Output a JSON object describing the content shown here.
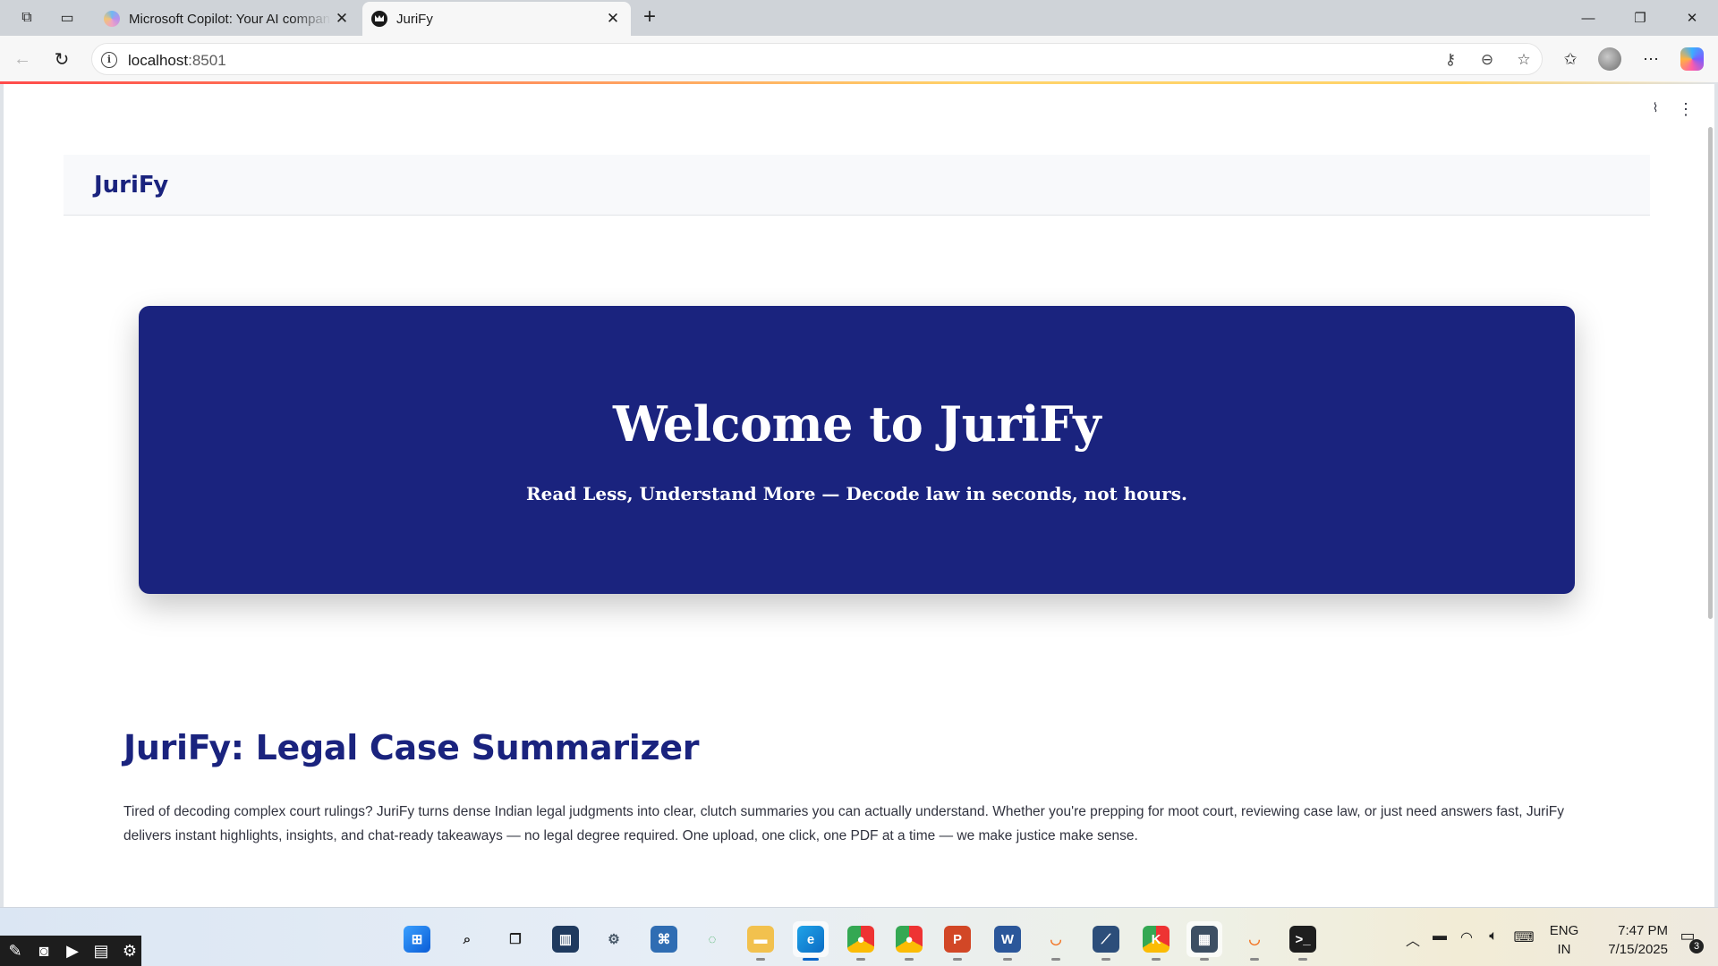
{
  "browser": {
    "tabs": [
      {
        "title": "Microsoft Copilot: Your AI companion",
        "active": false
      },
      {
        "title": "JuriFy",
        "active": true
      }
    ],
    "address": {
      "host": "localhost",
      "port": ":8501"
    },
    "window_controls": {
      "minimize": "—",
      "restore": "❐",
      "close": "✕"
    }
  },
  "app": {
    "header_brand": "JuriFy",
    "hero": {
      "title": "Welcome to JuriFy",
      "tagline": "Read Less, Understand More — Decode law in seconds, not hours."
    },
    "section_title": "JuriFy: Legal Case Summarizer",
    "description": "Tired of decoding complex court rulings? JuriFy turns dense Indian legal judgments into clear, clutch summaries you can actually understand. Whether you're prepping for moot court, reviewing case law, or just need answers fast, JuriFy delivers instant highlights, insights, and chat-ready takeaways — no legal degree required. One upload, one click, one PDF at a time — we make justice make sense.",
    "colors": {
      "primary": "#1a237e",
      "text": "#31333f",
      "header_bg": "#f8f9fb"
    }
  },
  "taskbar": {
    "apps": [
      {
        "name": "start",
        "label": ""
      },
      {
        "name": "search",
        "label": ""
      },
      {
        "name": "task-view",
        "label": ""
      },
      {
        "name": "widgets",
        "label": ""
      },
      {
        "name": "settings",
        "label": ""
      },
      {
        "name": "python",
        "label": ""
      },
      {
        "name": "loader",
        "label": ""
      },
      {
        "name": "file-explorer",
        "label": ""
      },
      {
        "name": "edge",
        "label": ""
      },
      {
        "name": "chrome",
        "label": ""
      },
      {
        "name": "chrome-profile",
        "label": ""
      },
      {
        "name": "powerpoint",
        "label": "P"
      },
      {
        "name": "word",
        "label": "W"
      },
      {
        "name": "jupyter",
        "label": ""
      },
      {
        "name": "vscode-like",
        "label": ""
      },
      {
        "name": "chrome-k",
        "label": "K"
      },
      {
        "name": "calculator",
        "label": ""
      },
      {
        "name": "jupyter-2",
        "label": ""
      },
      {
        "name": "terminal",
        "label": ""
      }
    ],
    "language": {
      "line1": "ENG",
      "line2": "IN"
    },
    "clock": {
      "time": "7:47 PM",
      "date": "7/15/2025"
    },
    "notification_count": "3"
  }
}
